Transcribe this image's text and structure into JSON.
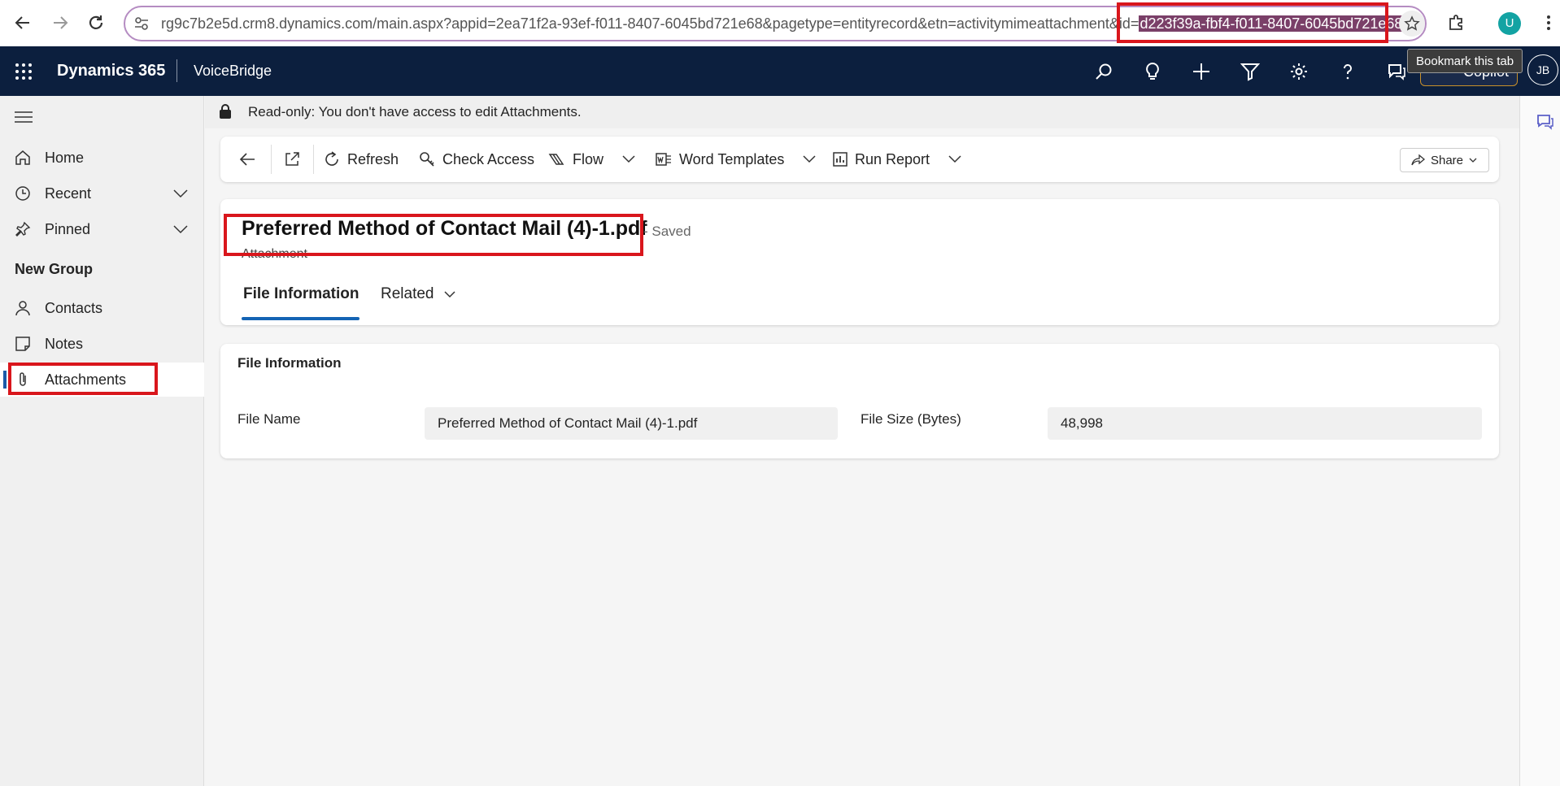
{
  "browser": {
    "url_prefix": "rg9c7b2e5d.crm8.dynamics.com/main.aspx?appid=2ea71f2a-93ef-f011-8407-6045bd721e68&pagetype=entityrecord&etn=activitymimeattachment&id=",
    "url_selected": "d223f39a-fbf4-f011-8407-6045bd721e68",
    "tooltip": "Bookmark this tab",
    "profile_initial": "U"
  },
  "header": {
    "brand": "Dynamics 365",
    "app_name": "VoiceBridge",
    "copilot_label": "Copilot",
    "user_initials": "JB"
  },
  "sidebar": {
    "home": "Home",
    "recent": "Recent",
    "pinned": "Pinned",
    "group_title": "New Group",
    "contacts": "Contacts",
    "notes": "Notes",
    "attachments": "Attachments"
  },
  "notice": {
    "text": "Read-only: You don't have access to edit Attachments."
  },
  "commands": {
    "refresh": "Refresh",
    "check_access": "Check Access",
    "flow": "Flow",
    "word_templates": "Word Templates",
    "run_report": "Run Report",
    "share": "Share"
  },
  "record": {
    "title": "Preferred Method of Contact Mail (4)-1.pdf",
    "status": "- Saved",
    "entity_type": "Attachment",
    "tabs": {
      "file_information": "File Information",
      "related": "Related"
    }
  },
  "file_info": {
    "section_title": "File Information",
    "file_name_label": "File Name",
    "file_name_value": "Preferred Method of Contact Mail (4)-1.pdf",
    "file_size_label": "File Size (Bytes)",
    "file_size_value": "48,998"
  },
  "colors": {
    "highlight": "#d9161c",
    "header_bg": "#0c1f3e",
    "accent": "#1464b4"
  }
}
